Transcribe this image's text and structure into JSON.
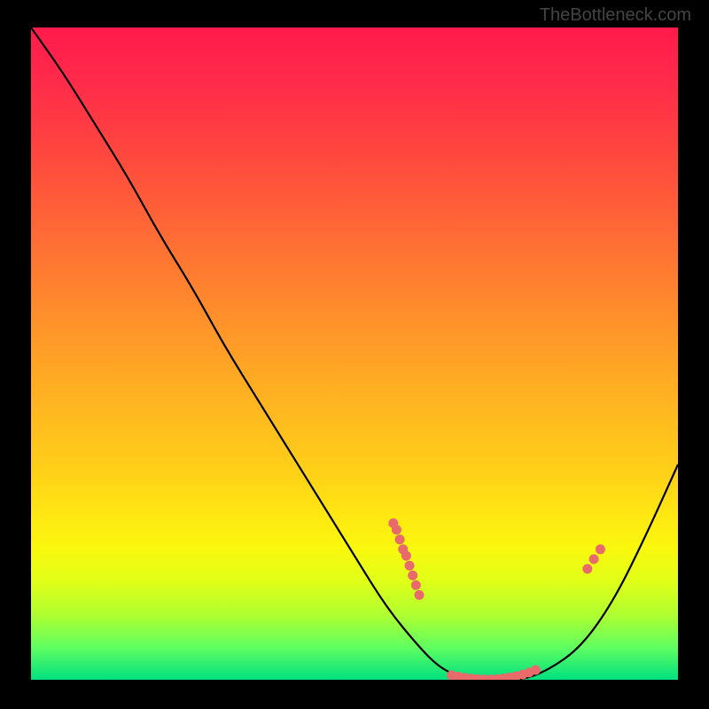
{
  "attribution": "TheBottleneck.com",
  "chart_data": {
    "type": "line",
    "title": "",
    "xlabel": "",
    "ylabel": "",
    "xlim": [
      0,
      100
    ],
    "ylim": [
      0,
      100
    ],
    "curve": {
      "x": [
        0,
        5,
        10,
        15,
        20,
        25,
        30,
        35,
        40,
        45,
        50,
        55,
        60,
        63,
        66,
        70,
        73,
        76,
        80,
        85,
        90,
        95,
        100
      ],
      "y": [
        100,
        93,
        85,
        77,
        68,
        60,
        51,
        43,
        35,
        27,
        19,
        11,
        5,
        2,
        0.5,
        0,
        0,
        0,
        1.5,
        5,
        12,
        22,
        33
      ]
    },
    "marker_clusters": [
      {
        "label": "left-slope",
        "points": [
          {
            "x": 56,
            "y": 24
          },
          {
            "x": 56.5,
            "y": 23
          },
          {
            "x": 57,
            "y": 21.5
          },
          {
            "x": 57.5,
            "y": 20
          },
          {
            "x": 58,
            "y": 19
          },
          {
            "x": 58.5,
            "y": 17.5
          },
          {
            "x": 59,
            "y": 16
          },
          {
            "x": 59.5,
            "y": 14.5
          },
          {
            "x": 60,
            "y": 13
          }
        ]
      },
      {
        "label": "valley",
        "points": [
          {
            "x": 65,
            "y": 0.7
          },
          {
            "x": 66,
            "y": 0.5
          },
          {
            "x": 67,
            "y": 0.3
          },
          {
            "x": 68,
            "y": 0.2
          },
          {
            "x": 69,
            "y": 0.1
          },
          {
            "x": 70,
            "y": 0.05
          },
          {
            "x": 71,
            "y": 0.05
          },
          {
            "x": 72,
            "y": 0.1
          },
          {
            "x": 73,
            "y": 0.2
          },
          {
            "x": 74,
            "y": 0.35
          },
          {
            "x": 75,
            "y": 0.55
          },
          {
            "x": 76,
            "y": 0.8
          },
          {
            "x": 77,
            "y": 1.1
          },
          {
            "x": 78,
            "y": 1.5
          }
        ]
      },
      {
        "label": "right-slope",
        "points": [
          {
            "x": 86,
            "y": 17
          },
          {
            "x": 87,
            "y": 18.5
          },
          {
            "x": 88,
            "y": 20
          }
        ]
      }
    ],
    "gradient_stops": [
      {
        "pos": 0,
        "color": "#ff1a4c"
      },
      {
        "pos": 18,
        "color": "#ff4340"
      },
      {
        "pos": 38,
        "color": "#ff7d30"
      },
      {
        "pos": 58,
        "color": "#ffb620"
      },
      {
        "pos": 75,
        "color": "#ffe812"
      },
      {
        "pos": 85,
        "color": "#e0ff18"
      },
      {
        "pos": 95,
        "color": "#60ff60"
      },
      {
        "pos": 100,
        "color": "#00e080"
      }
    ],
    "marker_color": "#e86a6a"
  }
}
